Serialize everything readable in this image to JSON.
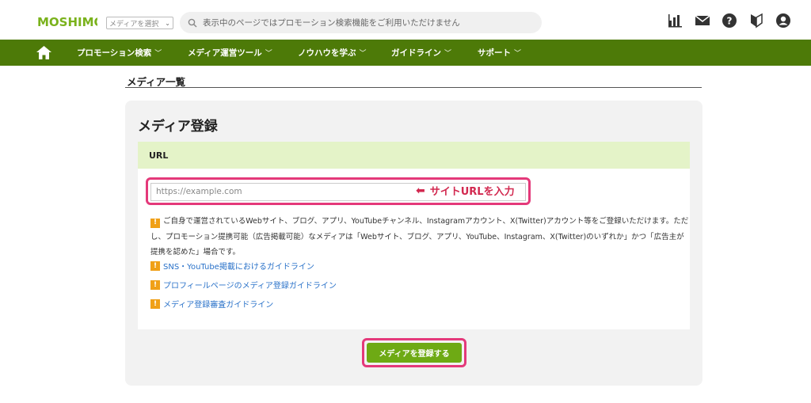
{
  "header": {
    "logo_text": "MOSHIMO",
    "media_select": {
      "value": "メディアを選択"
    },
    "search": {
      "placeholder": "表示中のページではプロモーション検索機能をご利用いただけません"
    },
    "icons": [
      "bar-chart-icon",
      "mail-icon",
      "help-icon",
      "beginner-mark-icon",
      "user-icon"
    ]
  },
  "nav": {
    "items": [
      {
        "label": "プロモーション検索"
      },
      {
        "label": "メディア運営ツール"
      },
      {
        "label": "ノウハウを学ぶ"
      },
      {
        "label": "ガイドライン"
      },
      {
        "label": "サポート"
      }
    ]
  },
  "page": {
    "title": "メディア一覧"
  },
  "panel": {
    "title": "メディア登録",
    "section_label": "URL",
    "url_input": {
      "placeholder": "https://example.com",
      "value": ""
    },
    "callout": "サイトURLを入力",
    "notice": "ご自身で運営されているWebサイト、ブログ、アプリ、YouTubeチャンネル、Instagramアカウント、X(Twitter)アカウント等をご登録いただけます。ただし、プロモーション提携可能（広告掲載可能）なメディアは「Webサイト、ブログ、アプリ、YouTube、Instagram、X(Twitter)のいずれか」かつ「広告主が提携を認めた」場合です。",
    "links": [
      {
        "label": "SNS・YouTube掲載におけるガイドライン"
      },
      {
        "label": "プロフィールページのメディア登録ガイドライン"
      },
      {
        "label": "メディア登録審査ガイドライン"
      }
    ],
    "submit_label": "メディアを登録する"
  },
  "colors": {
    "nav_green": "#4d7a08",
    "section_green": "#e4f3c8",
    "button_green": "#6eaa14",
    "highlight_pink": "#e4397a",
    "callout_red": "#d2284f",
    "link_blue": "#2a72c9",
    "warning_orange": "#f0a017"
  }
}
